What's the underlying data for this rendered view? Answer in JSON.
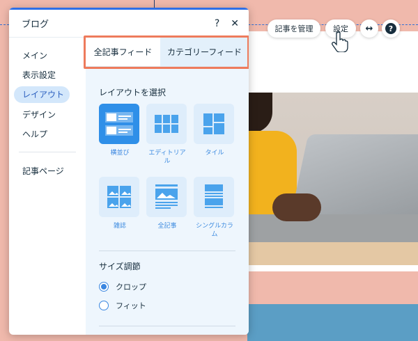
{
  "panel": {
    "title": "ブログ",
    "help_glyph": "?",
    "close_glyph": "✕"
  },
  "sidebar": {
    "items": [
      {
        "label": "メイン"
      },
      {
        "label": "表示設定"
      },
      {
        "label": "レイアウト"
      },
      {
        "label": "デザイン"
      },
      {
        "label": "ヘルプ"
      }
    ],
    "secondary": [
      {
        "label": "記事ページ"
      }
    ],
    "active_label": "レイアウト"
  },
  "tabs": [
    {
      "label": "全記事フィード"
    },
    {
      "label": "カテゴリーフィード"
    }
  ],
  "active_tab": "全記事フィード",
  "layout_section": {
    "title": "レイアウトを選択",
    "options": [
      {
        "label": "横並び",
        "icon": "side-by-side-layout-icon"
      },
      {
        "label": "エディトリアル",
        "icon": "editorial-layout-icon"
      },
      {
        "label": "タイル",
        "icon": "tiles-layout-icon"
      },
      {
        "label": "雑誌",
        "icon": "magazine-layout-icon"
      },
      {
        "label": "全記事",
        "icon": "full-post-layout-icon"
      },
      {
        "label": "シングルカラム",
        "icon": "one-column-layout-icon"
      }
    ],
    "selected": "横並び"
  },
  "size_section": {
    "title": "サイズ調節",
    "options": [
      {
        "label": "クロップ"
      },
      {
        "label": "フィット"
      }
    ],
    "selected": "クロップ"
  },
  "toolbar": {
    "manage_label": "記事を管理",
    "settings_label": "設定",
    "stretch_glyph": "↔",
    "help_glyph": "?"
  },
  "colors": {
    "accent": "#2f8fe8",
    "highlight_box": "#ee7b5c",
    "canvas_background": "#f0b9ac",
    "panel_topbar": "#2f6fe6"
  }
}
